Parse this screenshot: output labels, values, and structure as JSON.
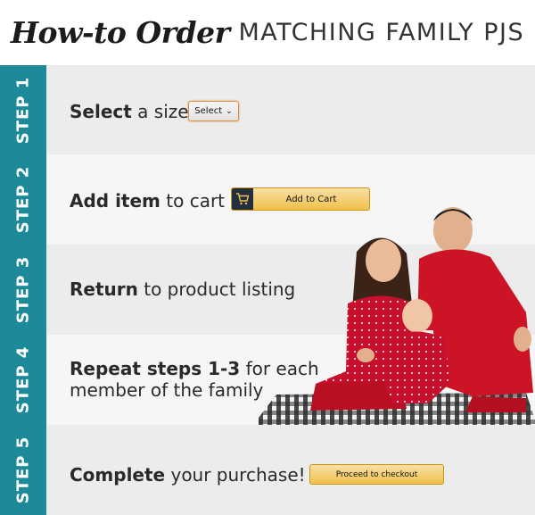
{
  "header": {
    "script_title": "How-to Order",
    "caps_title": "MATCHING FAMILY PJS"
  },
  "steps": [
    {
      "tab": "STEP 1",
      "bold": "Select",
      "rest": " a size"
    },
    {
      "tab": "STEP 2",
      "bold": "Add item",
      "rest": " to cart"
    },
    {
      "tab": "STEP 3",
      "bold": "Return",
      "rest": " to product listing"
    },
    {
      "tab": "STEP 4",
      "bold": "Repeat steps 1-3",
      "rest": " for each",
      "line2": "member of the family"
    },
    {
      "tab": "STEP 5",
      "bold": "Complete",
      "rest": " your purchase!"
    }
  ],
  "buttons": {
    "select_label": "Select",
    "add_to_cart_label": "Add to Cart",
    "checkout_label": "Proceed to checkout"
  },
  "icons": {
    "select_chevron": "chevron-down-icon",
    "cart": "shopping-cart-icon"
  },
  "colors": {
    "step_tab": "#1d8a99",
    "button_gold": "#f0c14b",
    "pajama_red": "#c8102e"
  }
}
